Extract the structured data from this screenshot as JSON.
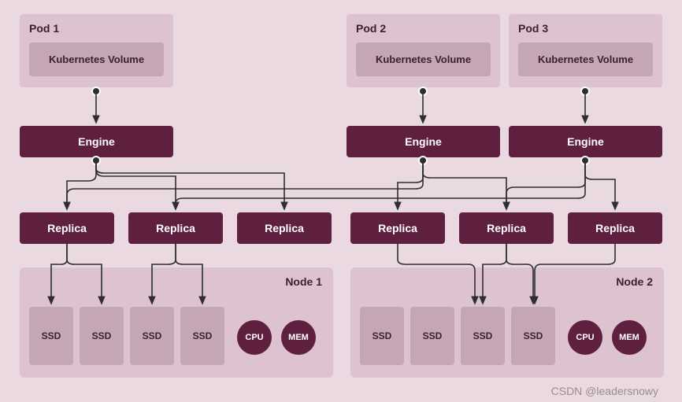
{
  "pods": [
    {
      "title": "Pod 1",
      "volume_label": "Kubernetes Volume"
    },
    {
      "title": "Pod 2",
      "volume_label": "Kubernetes Volume"
    },
    {
      "title": "Pod 3",
      "volume_label": "Kubernetes Volume"
    }
  ],
  "engines": [
    {
      "label": "Engine"
    },
    {
      "label": "Engine"
    },
    {
      "label": "Engine"
    }
  ],
  "replicas": [
    {
      "label": "Replica"
    },
    {
      "label": "Replica"
    },
    {
      "label": "Replica"
    },
    {
      "label": "Replica"
    },
    {
      "label": "Replica"
    },
    {
      "label": "Replica"
    }
  ],
  "nodes": [
    {
      "title": "Node 1",
      "ssds": [
        "SSD",
        "SSD",
        "SSD",
        "SSD"
      ],
      "cpu": "CPU",
      "mem": "MEM"
    },
    {
      "title": "Node 2",
      "ssds": [
        "SSD",
        "SSD",
        "SSD",
        "SSD"
      ],
      "cpu": "CPU",
      "mem": "MEM"
    }
  ],
  "watermark": "CSDN @leadersnowy",
  "colors": {
    "bg": "#ead9e1",
    "pod": "#dcc3cf",
    "inner": "#c5a6b5",
    "dark": "#5f203f"
  }
}
